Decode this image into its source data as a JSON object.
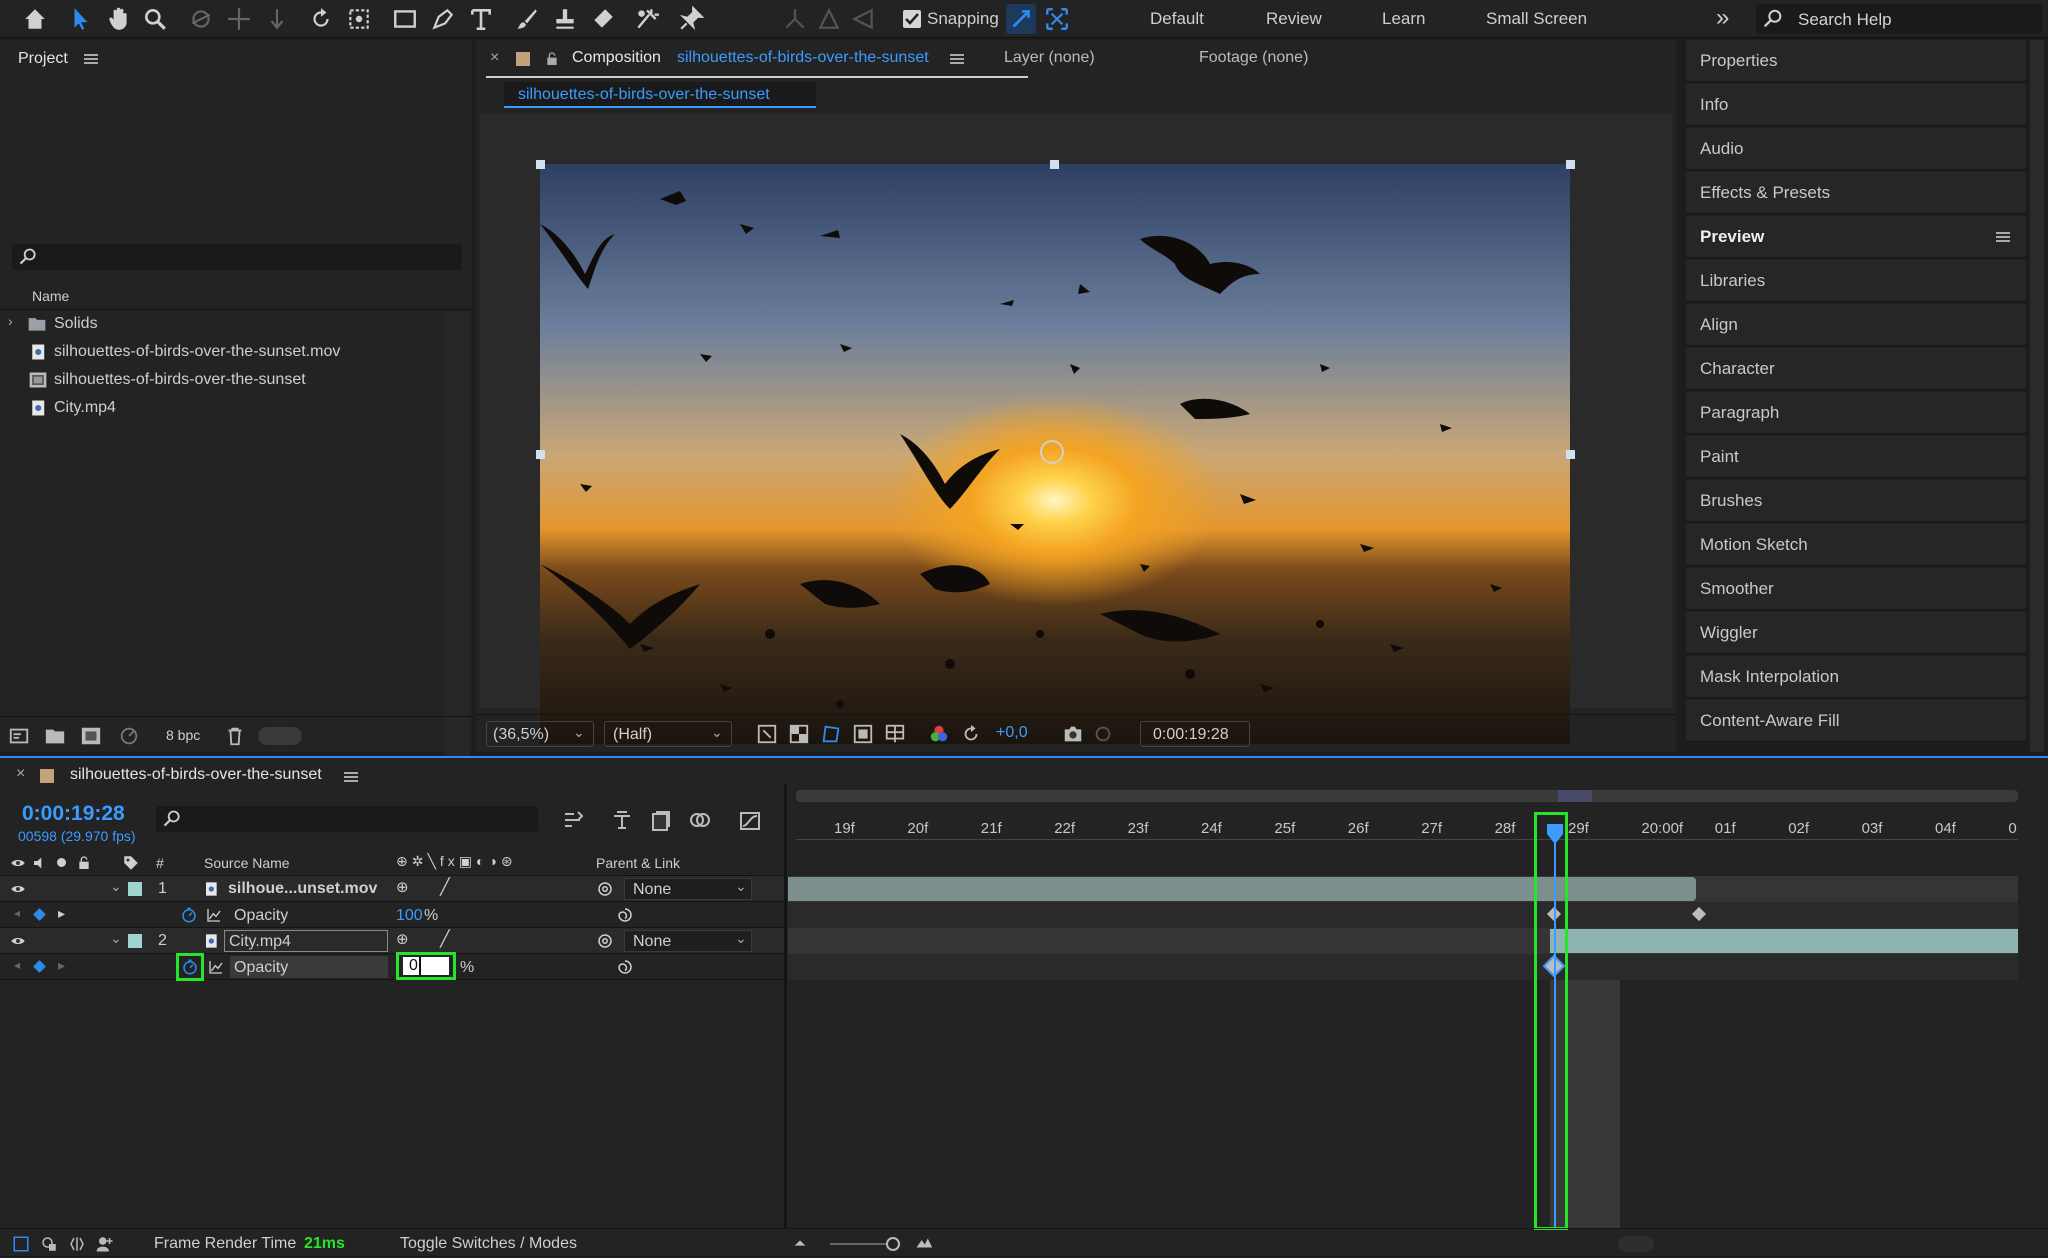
{
  "toolbar": {
    "snapping_label": "Snapping",
    "workspaces": [
      "Default",
      "Review",
      "Learn",
      "Small Screen"
    ],
    "search_placeholder": "Search Help"
  },
  "project": {
    "title": "Project",
    "column_name": "Name",
    "items": [
      {
        "label": "Solids",
        "icon": "folder-icon"
      },
      {
        "label": "silhouettes-of-birds-over-the-sunset.mov",
        "icon": "footage-icon"
      },
      {
        "label": "silhouettes-of-birds-over-the-sunset",
        "icon": "composition-icon"
      },
      {
        "label": "City.mp4",
        "icon": "footage-icon"
      }
    ],
    "bpc": "8 bpc"
  },
  "composition": {
    "tab_label": "Composition",
    "tab_name": "silhouettes-of-birds-over-the-sunset",
    "layer_tab": "Layer (none)",
    "footage_tab": "Footage (none)",
    "sub_tab": "silhouettes-of-birds-over-the-sunset",
    "zoom": "(36,5%)",
    "resolution": "(Half)",
    "exposure": "+0,0",
    "timecode": "0:00:19:28"
  },
  "right_panels": [
    "Properties",
    "Info",
    "Audio",
    "Effects & Presets",
    "Preview",
    "Libraries",
    "Align",
    "Character",
    "Paragraph",
    "Paint",
    "Brushes",
    "Motion Sketch",
    "Smoother",
    "Wiggler",
    "Mask Interpolation",
    "Content-Aware Fill"
  ],
  "timeline": {
    "comp_name": "silhouettes-of-birds-over-the-sunset",
    "timecode": "0:00:19:28",
    "frame_info": "00598 (29.970 fps)",
    "col_source": "Source Name",
    "col_parent": "Parent & Link",
    "col_hash": "#",
    "ticks": [
      "19f",
      "20f",
      "21f",
      "22f",
      "23f",
      "24f",
      "25f",
      "26f",
      "27f",
      "28f",
      "29f",
      "20:00f",
      "01f",
      "02f",
      "03f",
      "04f",
      "0"
    ],
    "layers": [
      {
        "num": "1",
        "name": "silhoue...unset.mov",
        "parent": "None",
        "prop": "Opacity",
        "prop_value": "100",
        "unit": "%"
      },
      {
        "num": "2",
        "name": "City.mp4",
        "parent": "None",
        "prop": "Opacity",
        "prop_value": "0",
        "unit": "%"
      }
    ],
    "frame_render_label": "Frame Render Time",
    "frame_render_value": "21ms",
    "toggle_label": "Toggle Switches / Modes"
  }
}
